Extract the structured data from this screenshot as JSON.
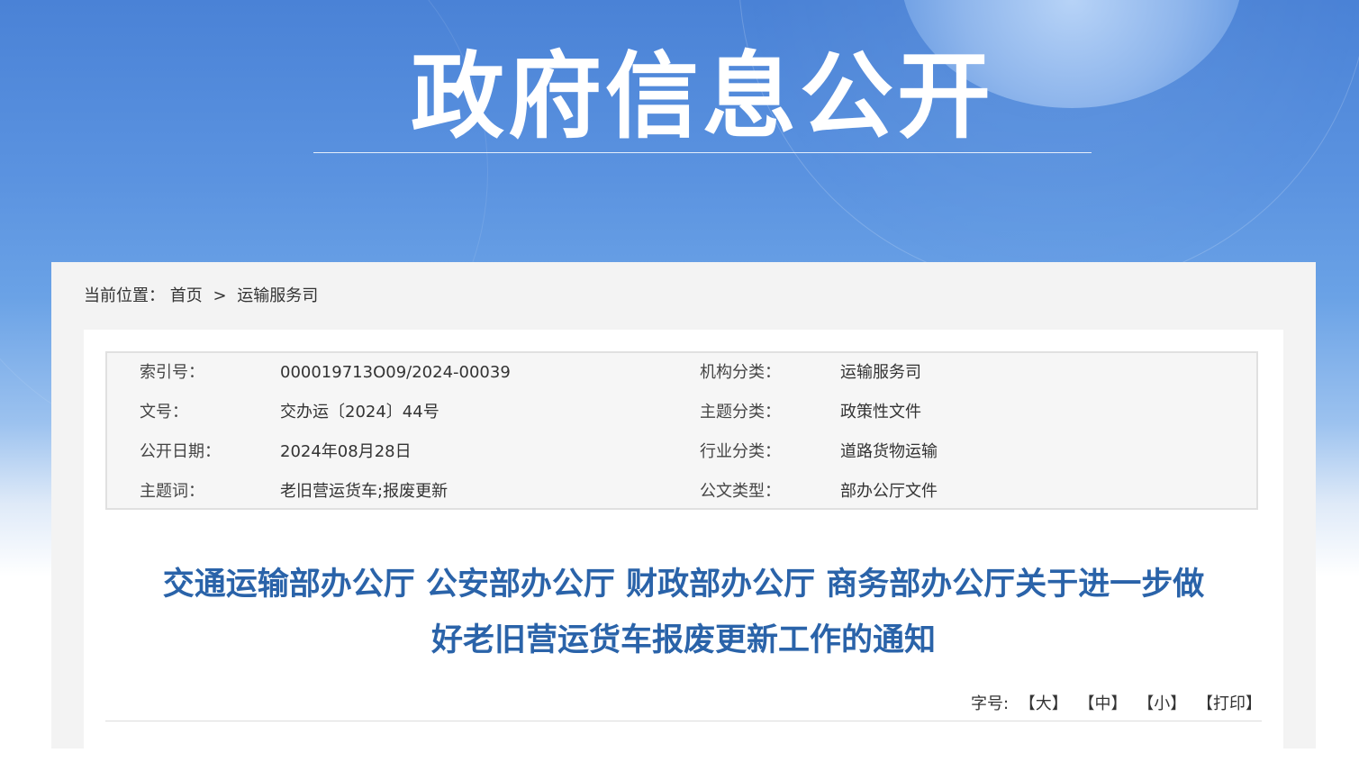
{
  "banner": {
    "title": "政府信息公开"
  },
  "breadcrumb": {
    "prefix": "当前位置：",
    "home": "首页",
    "separator": ">",
    "current": "运输服务司"
  },
  "meta": {
    "index_label": "索引号：",
    "index_value": "000019713O09/2024-00039",
    "org_label": "机构分类：",
    "org_value": "运输服务司",
    "docno_label": "文号：",
    "docno_value": "交办运〔2024〕44号",
    "topic_label": "主题分类：",
    "topic_value": "政策性文件",
    "date_label": "公开日期：",
    "date_value": "2024年08月28日",
    "industry_label": "行业分类：",
    "industry_value": "道路货物运输",
    "keywords_label": "主题词：",
    "keywords_value": "老旧营运货车;报废更新",
    "doctype_label": "公文类型：",
    "doctype_value": "部办公厅文件"
  },
  "document": {
    "title_line1": "交通运输部办公厅 公安部办公厅 财政部办公厅 商务部办公厅关于进一步做",
    "title_line2": "好老旧营运货车报废更新工作的通知"
  },
  "font_size_bar": {
    "label": "字号:",
    "large": "【大】",
    "medium": "【中】",
    "small": "【小】",
    "print": "【打印】"
  },
  "colors": {
    "banner_blue": "#4a82d6",
    "title_blue": "#2a63a9"
  }
}
